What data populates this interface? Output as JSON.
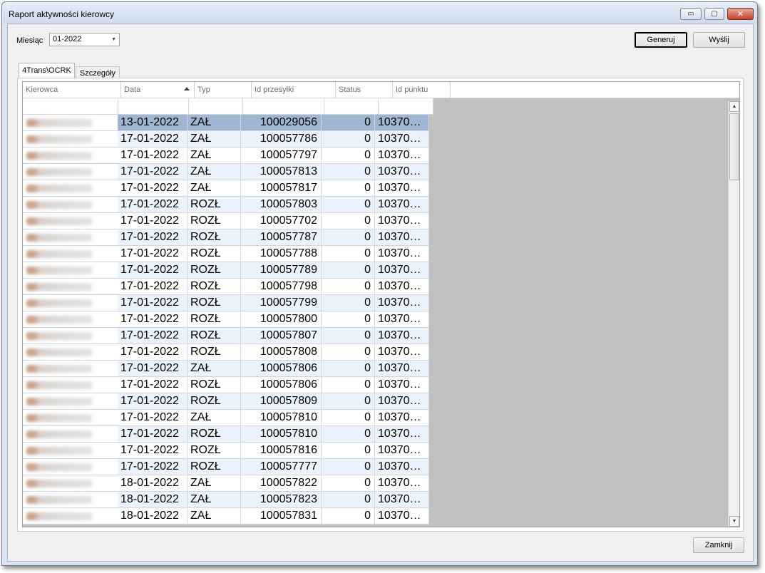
{
  "window": {
    "title": "Raport aktywności kierowcy",
    "min_label": "▭",
    "max_label": "▢",
    "close_label": "✕"
  },
  "toolbar": {
    "month_label": "Miesiąc",
    "month_value": "01-2022",
    "generate_label": "Generuj",
    "send_label": "Wyślij"
  },
  "tabs": [
    {
      "label": "4Trans\\OCRK",
      "active": true
    },
    {
      "label": "Szczegóły",
      "active": false
    }
  ],
  "grid": {
    "columns": [
      "Kierowca",
      "Data",
      "Typ",
      "Id przesyłki",
      "Status",
      "Id punktu"
    ],
    "sorted_column": "Data",
    "rows": [
      [
        "",
        "13-01-2022",
        "ZAŁ",
        "100029056",
        "0",
        "10370…"
      ],
      [
        "",
        "17-01-2022",
        "ZAŁ",
        "100057786",
        "0",
        "10370…"
      ],
      [
        "",
        "17-01-2022",
        "ZAŁ",
        "100057797",
        "0",
        "10370…"
      ],
      [
        "",
        "17-01-2022",
        "ZAŁ",
        "100057813",
        "0",
        "10370…"
      ],
      [
        "",
        "17-01-2022",
        "ZAŁ",
        "100057817",
        "0",
        "10370…"
      ],
      [
        "",
        "17-01-2022",
        "ROZŁ",
        "100057803",
        "0",
        "10370…"
      ],
      [
        "",
        "17-01-2022",
        "ROZŁ",
        "100057702",
        "0",
        "10370…"
      ],
      [
        "",
        "17-01-2022",
        "ROZŁ",
        "100057787",
        "0",
        "10370…"
      ],
      [
        "",
        "17-01-2022",
        "ROZŁ",
        "100057788",
        "0",
        "10370…"
      ],
      [
        "",
        "17-01-2022",
        "ROZŁ",
        "100057789",
        "0",
        "10370…"
      ],
      [
        "",
        "17-01-2022",
        "ROZŁ",
        "100057798",
        "0",
        "10370…"
      ],
      [
        "",
        "17-01-2022",
        "ROZŁ",
        "100057799",
        "0",
        "10370…"
      ],
      [
        "",
        "17-01-2022",
        "ROZŁ",
        "100057800",
        "0",
        "10370…"
      ],
      [
        "",
        "17-01-2022",
        "ROZŁ",
        "100057807",
        "0",
        "10370…"
      ],
      [
        "",
        "17-01-2022",
        "ROZŁ",
        "100057808",
        "0",
        "10370…"
      ],
      [
        "",
        "17-01-2022",
        "ZAŁ",
        "100057806",
        "0",
        "10370…"
      ],
      [
        "",
        "17-01-2022",
        "ROZŁ",
        "100057806",
        "0",
        "10370…"
      ],
      [
        "",
        "17-01-2022",
        "ROZŁ",
        "100057809",
        "0",
        "10370…"
      ],
      [
        "",
        "17-01-2022",
        "ZAŁ",
        "100057810",
        "0",
        "10370…"
      ],
      [
        "",
        "17-01-2022",
        "ROZŁ",
        "100057810",
        "0",
        "10370…"
      ],
      [
        "",
        "17-01-2022",
        "ROZŁ",
        "100057816",
        "0",
        "10370…"
      ],
      [
        "",
        "17-01-2022",
        "ROZŁ",
        "100057777",
        "0",
        "10370…"
      ],
      [
        "",
        "18-01-2022",
        "ZAŁ",
        "100057822",
        "0",
        "10370…"
      ],
      [
        "",
        "18-01-2022",
        "ZAŁ",
        "100057823",
        "0",
        "10370…"
      ],
      [
        "",
        "18-01-2022",
        "ZAŁ",
        "100057831",
        "0",
        "10370…"
      ]
    ],
    "selected_row": 0
  },
  "footer": {
    "close_label": "Zamknij"
  },
  "colors": {
    "selected_row": "#9eb6d1",
    "alt_row": "#eaf3fb",
    "empty_area": "#c0c0c0"
  }
}
